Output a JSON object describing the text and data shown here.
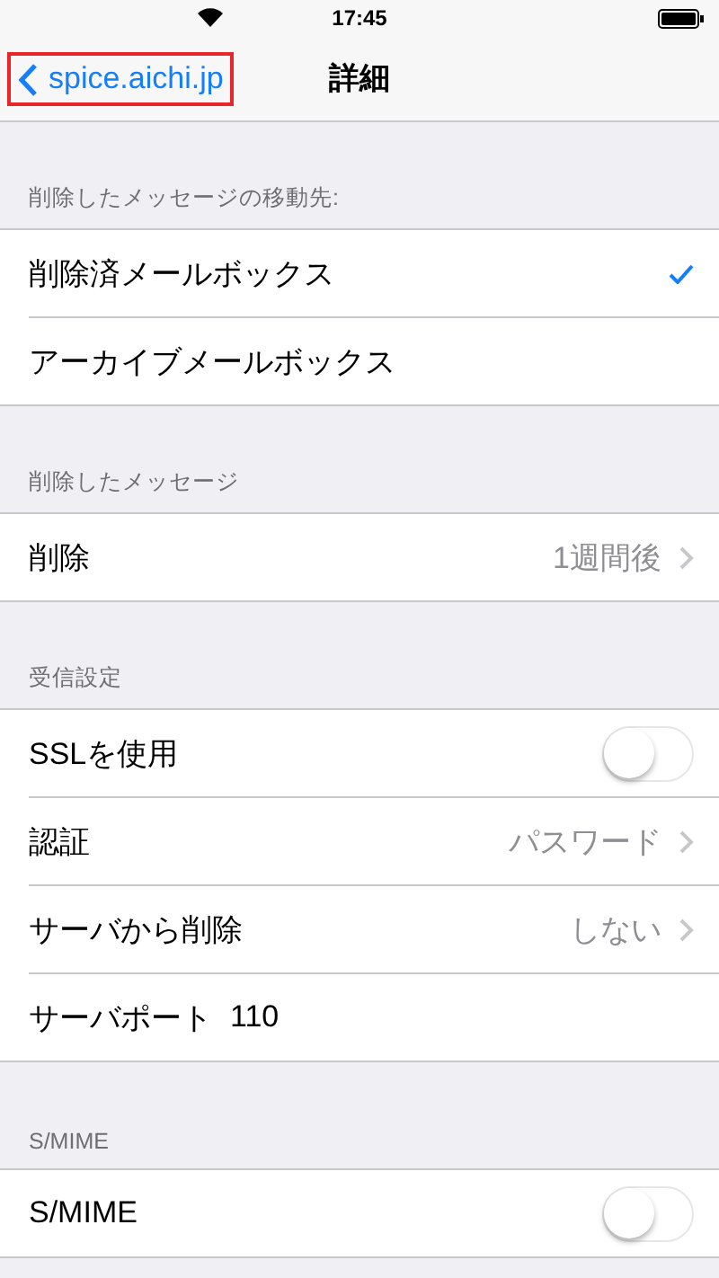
{
  "status_bar": {
    "time": "17:45"
  },
  "nav": {
    "back": {
      "label": "spice.aichi.jp",
      "highlighted": true
    },
    "title": "詳細"
  },
  "sections": [
    {
      "header": "削除したメッセージの移動先:",
      "rows": [
        {
          "kind": "check",
          "label": "削除済メールボックス",
          "checked": true
        },
        {
          "kind": "check",
          "label": "アーカイブメールボックス",
          "checked": false
        }
      ]
    },
    {
      "header": "削除したメッセージ",
      "rows": [
        {
          "kind": "link",
          "label": "削除",
          "value": "1週間後"
        }
      ]
    },
    {
      "header": "受信設定",
      "rows": [
        {
          "kind": "toggle",
          "label": "SSLを使用",
          "on": false
        },
        {
          "kind": "link",
          "label": "認証",
          "value": "パスワード"
        },
        {
          "kind": "link",
          "label": "サーバから削除",
          "value": "しない"
        },
        {
          "kind": "field",
          "label": "サーバポート",
          "value": "110"
        }
      ]
    },
    {
      "header": "S/MIME",
      "rows": [
        {
          "kind": "toggle",
          "label": "S/MIME",
          "on": false
        }
      ]
    }
  ]
}
